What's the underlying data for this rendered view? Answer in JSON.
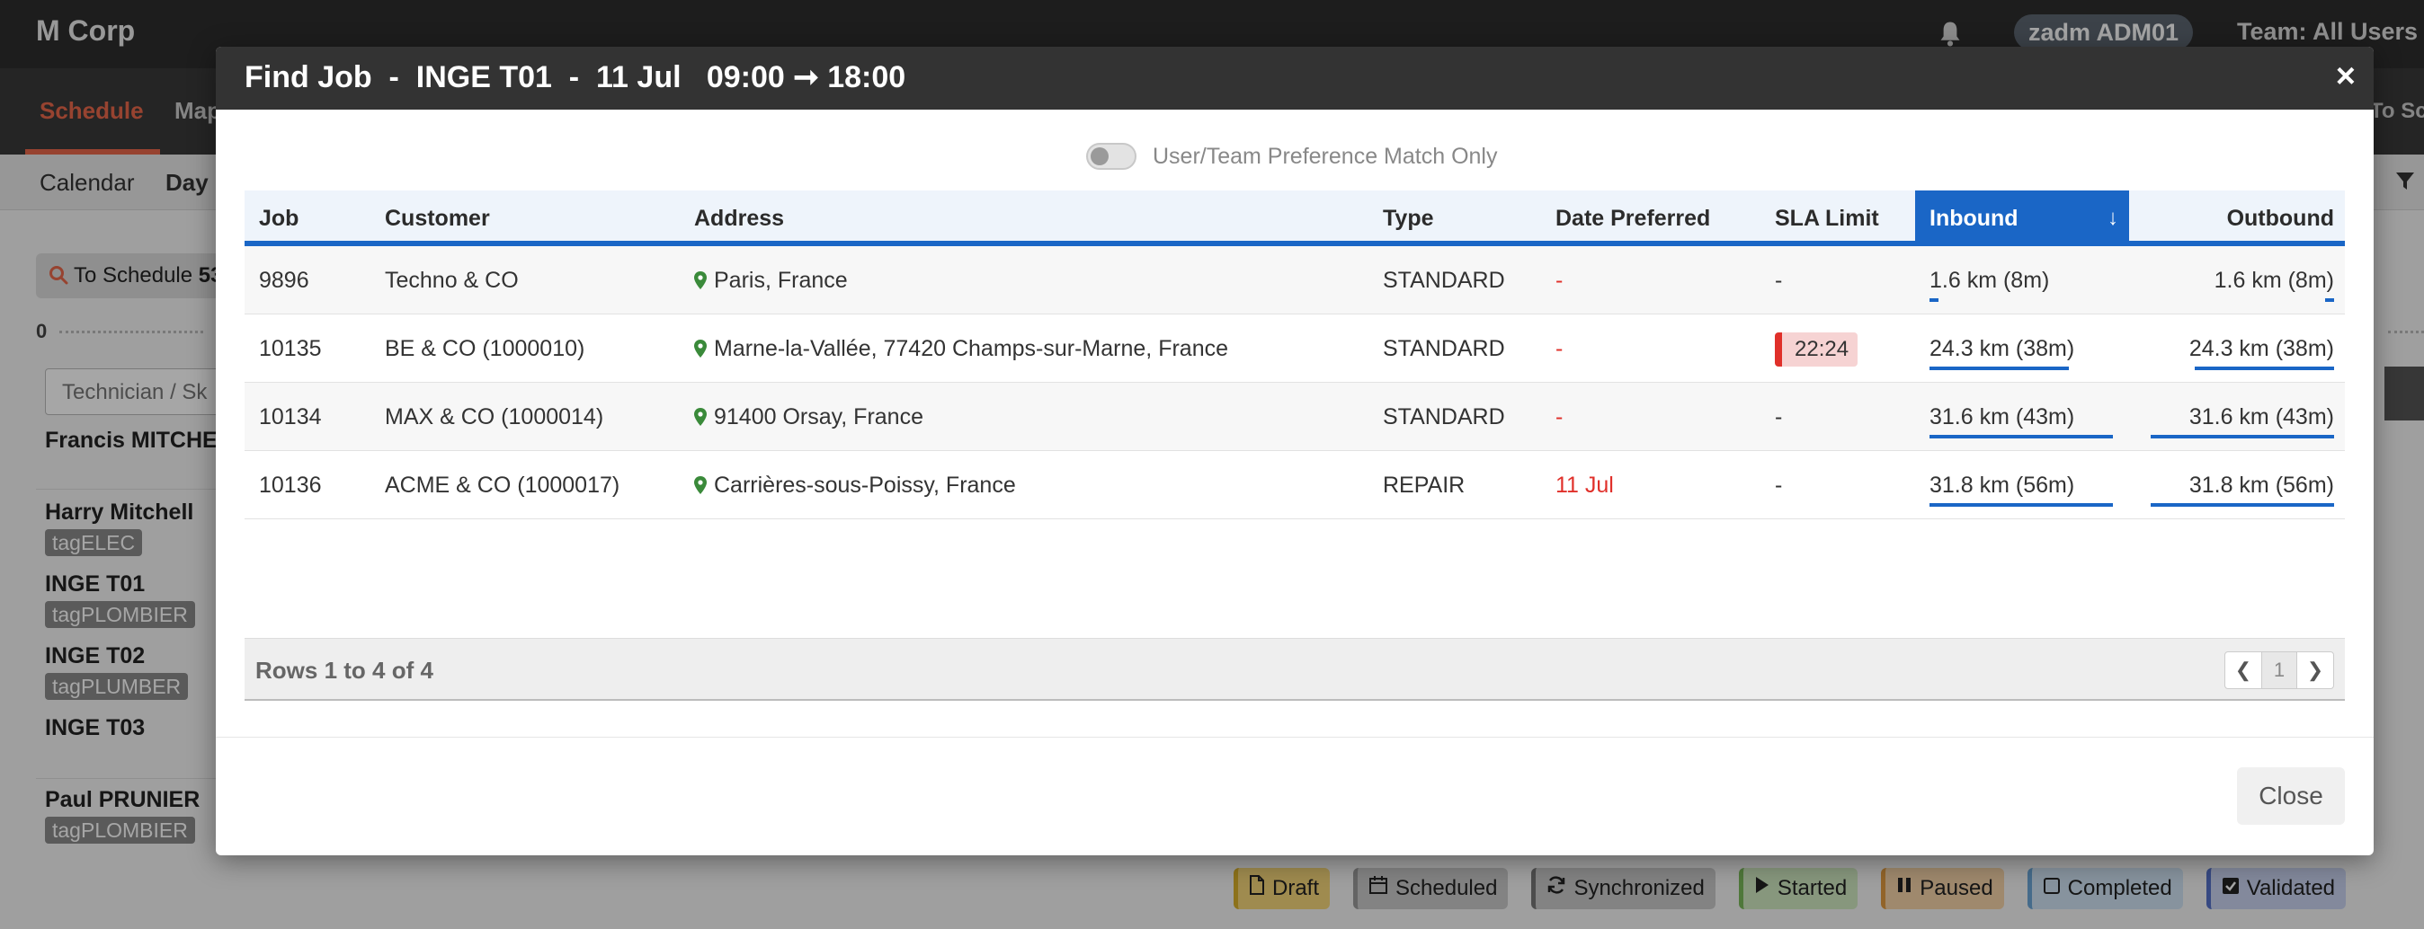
{
  "app": {
    "brand": "M Corp",
    "user": "zadm ADM01",
    "team": "Team: All Users",
    "nav_tabs": [
      "Schedule",
      "Map"
    ],
    "nav_right": "To Sc",
    "subnav": [
      "Calendar",
      "Day"
    ],
    "to_schedule_label": "To Schedule",
    "to_schedule_count": "53",
    "ruler_start": "0",
    "tech_filter_placeholder": "Technician / Sk",
    "technicians": [
      {
        "name": "Francis MITCHEL",
        "tag": ""
      },
      {
        "name": "Harry Mitchell",
        "tag": "tagELEC"
      },
      {
        "name": "INGE T01",
        "tag": "tagPLOMBIER"
      },
      {
        "name": "INGE T02",
        "tag": "tagPLUMBER"
      },
      {
        "name": "INGE T03",
        "tag": ""
      },
      {
        "name": "Paul PRUNIER",
        "tag": "tagPLOMBIER"
      }
    ],
    "legend": [
      {
        "label": "Draft",
        "icon": "file-icon",
        "color": "#f5d67a",
        "edge": "#d9b02a"
      },
      {
        "label": "Scheduled",
        "icon": "calendar-icon",
        "color": "#c9c9c9",
        "edge": "#9a9a9a"
      },
      {
        "label": "Synchronized",
        "icon": "refresh-icon",
        "color": "#c9c9c9",
        "edge": "#777"
      },
      {
        "label": "Started",
        "icon": "play-icon",
        "color": "#cfe8c0",
        "edge": "#7ab85a"
      },
      {
        "label": "Paused",
        "icon": "pause-icon",
        "color": "#f5d3a8",
        "edge": "#e09a40"
      },
      {
        "label": "Completed",
        "icon": "square-icon",
        "color": "#cfe2f3",
        "edge": "#6aa5d6"
      },
      {
        "label": "Validated",
        "icon": "check-square-icon",
        "color": "#c9d3f0",
        "edge": "#5570c8"
      }
    ]
  },
  "modal": {
    "title": "Find Job  -  INGE T01  -  11 Jul   09:00 ➞ 18:00",
    "close_x": "×",
    "toggle_label": "User/Team Preference Match Only",
    "columns": [
      "Job",
      "Customer",
      "Address",
      "Type",
      "Date Preferred",
      "SLA Limit",
      "Inbound",
      "Outbound"
    ],
    "sort_icon": "arrow-down-icon",
    "rows": [
      {
        "job": "9896",
        "customer": "Techno & CO",
        "address": "Paris, France",
        "type": "STANDARD",
        "date_preferred": "-",
        "sla_limit": "-",
        "inbound": "1.6 km (8m)",
        "inbound_frac": 0.05,
        "outbound": "1.6 km (8m)",
        "outbound_frac": 0.05
      },
      {
        "job": "10135",
        "customer": "BE & CO (1000010)",
        "address": "Marne-la-Vallée, 77420 Champs-sur-Marne, France",
        "type": "STANDARD",
        "date_preferred": "-",
        "sla_limit": "22:24",
        "sla_alert": true,
        "inbound": "24.3 km (38m)",
        "inbound_frac": 0.76,
        "outbound": "24.3 km (38m)",
        "outbound_frac": 0.76
      },
      {
        "job": "10134",
        "customer": "MAX & CO (1000014)",
        "address": "91400 Orsay, France",
        "type": "STANDARD",
        "date_preferred": "-",
        "sla_limit": "-",
        "inbound": "31.6 km (43m)",
        "inbound_frac": 1.0,
        "outbound": "31.6 km (43m)",
        "outbound_frac": 1.0
      },
      {
        "job": "10136",
        "customer": "ACME & CO (1000017)",
        "address": "Carrières-sous-Poissy, France",
        "type": "REPAIR",
        "date_preferred": "11 Jul",
        "sla_limit": "-",
        "inbound": "31.8 km (56m)",
        "inbound_frac": 1.0,
        "outbound": "31.8 km (56m)",
        "outbound_frac": 1.0
      }
    ],
    "rows_label": "Rows 1 to 4 of 4",
    "page": "1",
    "close_label": "Close"
  }
}
